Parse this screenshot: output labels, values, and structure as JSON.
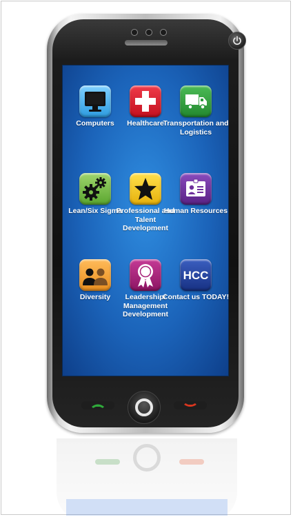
{
  "colors": {
    "screen": "#1b63b9",
    "computers": "#3aa8e8",
    "healthcare": "#d6182b",
    "transportation": "#2c9a3c",
    "lean": "#7cc04a",
    "professional": "#f3c61d",
    "human_resources": "#6f2f9c",
    "diversity": "#f2a236",
    "leadership": "#a8237a",
    "contact": "#1f3f98"
  },
  "tiles": [
    {
      "label": "Computers",
      "icon": "monitor-icon"
    },
    {
      "label": "Healthcare",
      "icon": "medical-cross-icon"
    },
    {
      "label": "Transportation and Logistics",
      "icon": "truck-icon"
    },
    {
      "label": "Lean/Six Sigma",
      "icon": "gears-icon"
    },
    {
      "label": "Professional and Talent Development",
      "icon": "star-icon"
    },
    {
      "label": "Human Resources",
      "icon": "id-badge-icon"
    },
    {
      "label": "Diversity",
      "icon": "people-icon"
    },
    {
      "label": "Leadership/ Management Development",
      "icon": "award-ribbon-icon"
    },
    {
      "label": "Contact us TODAY!",
      "icon": "hcc-logo-icon"
    }
  ],
  "hcc_logo_text": "HCC"
}
